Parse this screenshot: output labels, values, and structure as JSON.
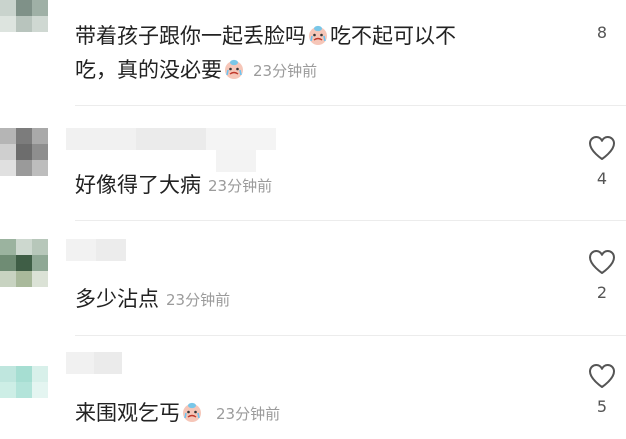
{
  "comments": [
    {
      "text_a": "带着孩子跟你一起丢脸吗",
      "emoji_a": "crying-face-emoji",
      "text_b": "吃不起可以不",
      "text_c": "吃，真的没必要",
      "emoji_b": "crying-face-emoji",
      "time": "23分钟前",
      "likes": "8"
    },
    {
      "text": "好像得了大病",
      "time": "23分钟前",
      "likes": "4"
    },
    {
      "text": "多少沾点",
      "time": "23分钟前",
      "likes": "2"
    },
    {
      "text": "来围观乞丐",
      "emoji": "crying-face-emoji",
      "time": "23分钟前",
      "likes": "5"
    }
  ],
  "colors": {
    "text": "#222222",
    "time": "#9b9b9b",
    "heart_stroke": "#555555",
    "divider": "#ececec"
  }
}
